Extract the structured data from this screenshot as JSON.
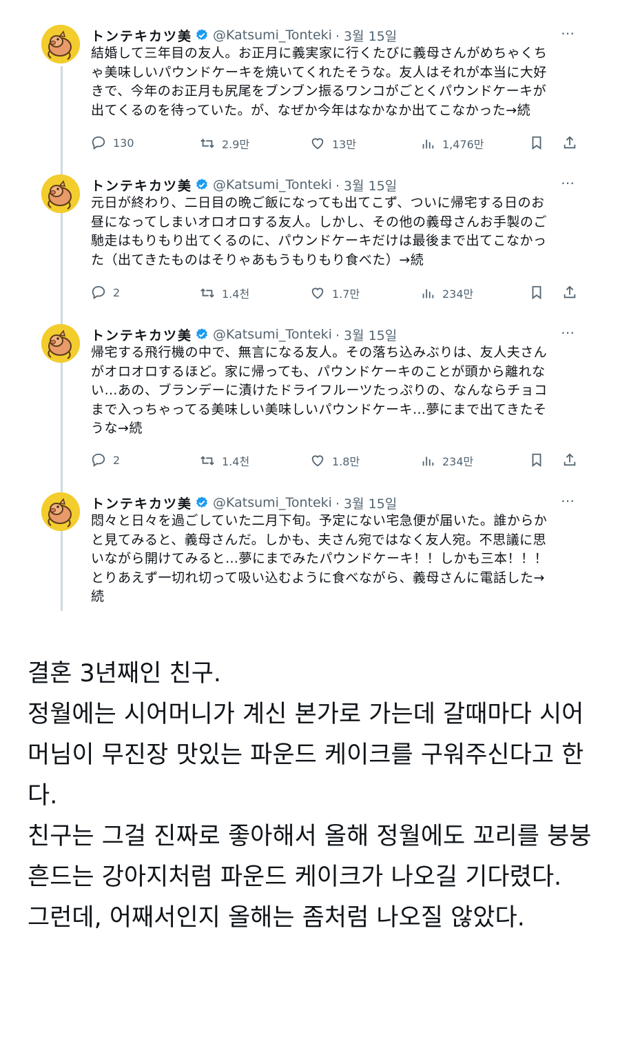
{
  "author": {
    "name": "トンテキカツ美",
    "handle": "@Katsumi_Tonteki",
    "date": "· 3월 15일"
  },
  "more_icon": "⋯",
  "tweets": [
    {
      "text": "結婚して三年目の友人。お正月に義実家に行くたびに義母さんがめちゃくち\nゃ美味しいパウンドケーキを焼いてくれたそうな。友人はそれが本当に大好\nきで、今年のお正月も尻尾をブンブン振るワンコがごとくパウンドケーキが\n出てくるのを待っていた。が、なぜか今年はなかなか出てこなかった→続",
      "replies": "130",
      "retweets": "2.9만",
      "likes": "13만",
      "views": "1,476만"
    },
    {
      "text": "元日が終わり、二日目の晩ご飯になっても出てこず、ついに帰宅する日のお\n昼になってしまいオロオロする友人。しかし、その他の義母さんお手製のご\n馳走はもりもり出てくるのに、パウンドケーキだけは最後まで出てこなかっ\nた（出てきたものはそりゃあもうもりもり食べた）→続",
      "replies": "2",
      "retweets": "1.4천",
      "likes": "1.7만",
      "views": "234만"
    },
    {
      "text": "帰宅する飛行機の中で、無言になる友人。その落ち込みぶりは、友人夫さん\nがオロオロするほど。家に帰っても、パウンドケーキのことが頭から離れな\nい…あの、ブランデーに漬けたドライフルーツたっぷりの、なんならチョコ\nまで入っちゃってる美味しい美味しいパウンドケーキ…夢にまで出てきたそ\nうな→続",
      "replies": "2",
      "retweets": "1.4천",
      "likes": "1.8만",
      "views": "234만"
    },
    {
      "text": "悶々と日々を過ごしていた二月下旬。予定にない宅急便が届いた。誰からか\nと見てみると、義母さんだ。しかも、夫さん宛ではなく友人宛。不思議に思\nいながら開けてみると…夢にまでみたパウンドケーキ！！しかも三本！！！\nとりあえず一切れ切って吸い込むように食べながら、義母さんに電話した→\n続"
    }
  ],
  "korean_translation": "결혼 3년째인 친구.\n정월에는 시어머니가 계신 본가로 가는데 갈때마다 시어머님이 무진장 맛있는 파운드 케이크를 구워주신다고 한다.\n친구는 그걸 진짜로 좋아해서 올해 정월에도 꼬리를 붕붕 흔드는 강아지처럼 파운드 케이크가 나오길 기다렸다.\n그런데, 어째서인지 올해는 좀처럼 나오질 않았다.",
  "colors": {
    "text": "#0f1419",
    "secondary": "#536471",
    "thread_line": "#cfd9de",
    "verified": "#1d9bf0",
    "avatar_bg": "#f3cc2e"
  }
}
